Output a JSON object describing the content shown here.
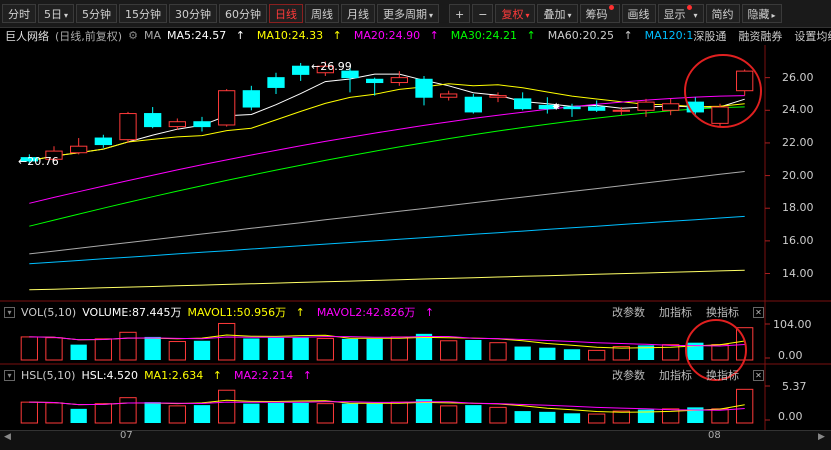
{
  "toolbar": {
    "periods": [
      "分时",
      "5日",
      "5分钟",
      "15分钟",
      "30分钟",
      "60分钟",
      "日线",
      "周线",
      "月线",
      "更多周期"
    ],
    "active_period": "日线",
    "plus": "+",
    "minus": "−",
    "fuquan": "复权",
    "diejia": "叠加",
    "chouma": "筹码",
    "huaxian": "画线",
    "xianshi": "显示",
    "jianyue": "简约",
    "yincang": "隐藏"
  },
  "ma_bar": {
    "stock_name": "巨人网络",
    "mode": "(日线,前复权)",
    "ma_label": "MA",
    "ma5": "MA5:24.57",
    "ma10": "MA10:24.33",
    "ma20": "MA20:24.90",
    "ma30": "MA30:24.21",
    "ma60": "MA60:20.25",
    "ma120": "MA120:1",
    "shengutong": "深股通",
    "rongzi": "融资融券",
    "shezhi": "设置均线",
    "colors": {
      "ma5": "#ffffff",
      "ma10": "#ffff00",
      "ma20": "#ff00ff",
      "ma30": "#00ff00",
      "ma60": "#aaaaaa",
      "ma120": "#00bfff"
    }
  },
  "price_axis": [
    "26.00",
    "24.00",
    "22.00",
    "20.00",
    "18.00",
    "16.00",
    "14.00"
  ],
  "annotations": {
    "high": "26.99",
    "low": "20.76",
    "star": "✸"
  },
  "vol_panel": {
    "title": "VOL(5,10)",
    "volume": "VOLUME:87.445万",
    "mavol1": "MAVOL1:50.956万",
    "mavol2": "MAVOL2:42.826万",
    "gaicanshu": "改参数",
    "jiazhibiao": "加指标",
    "huanzhibiao": "换指标",
    "close": "✕",
    "axis": [
      "104.00",
      "0.00"
    ]
  },
  "hsl_panel": {
    "title": "HSL(5,10)",
    "hsl": "HSL:4.520",
    "ma1": "MA1:2.634",
    "ma2": "MA2:2.214",
    "gaicanshu": "改参数",
    "jiazhibiao": "加指标",
    "huanzhibiao": "换指标",
    "close": "✕",
    "axis": [
      "5.37",
      "0.00"
    ]
  },
  "x_axis": {
    "left": "07",
    "right": "08"
  },
  "candles": [
    {
      "o": 21.1,
      "c": 20.9,
      "h": 21.3,
      "l": 20.76,
      "up": false
    },
    {
      "o": 21.0,
      "c": 21.5,
      "h": 21.8,
      "l": 20.9,
      "up": true
    },
    {
      "o": 21.4,
      "c": 21.8,
      "h": 22.3,
      "l": 21.3,
      "up": true
    },
    {
      "o": 21.9,
      "c": 22.3,
      "h": 22.5,
      "l": 21.7,
      "up": false
    },
    {
      "o": 22.2,
      "c": 23.8,
      "h": 23.9,
      "l": 22.0,
      "up": true
    },
    {
      "o": 23.8,
      "c": 23.0,
      "h": 24.2,
      "l": 22.9,
      "up": false
    },
    {
      "o": 23.0,
      "c": 23.3,
      "h": 23.5,
      "l": 22.8,
      "up": true
    },
    {
      "o": 23.3,
      "c": 23.0,
      "h": 23.6,
      "l": 22.7,
      "up": false
    },
    {
      "o": 23.1,
      "c": 25.2,
      "h": 25.3,
      "l": 23.0,
      "up": true
    },
    {
      "o": 25.2,
      "c": 24.2,
      "h": 25.5,
      "l": 24.0,
      "up": false
    },
    {
      "o": 25.4,
      "c": 26.0,
      "h": 26.3,
      "l": 25.0,
      "up": false
    },
    {
      "o": 26.2,
      "c": 26.7,
      "h": 26.9,
      "l": 25.8,
      "up": false
    },
    {
      "o": 26.3,
      "c": 26.7,
      "h": 26.99,
      "l": 26.1,
      "up": true
    },
    {
      "o": 26.4,
      "c": 26.0,
      "h": 26.6,
      "l": 25.1,
      "up": false
    },
    {
      "o": 25.9,
      "c": 25.7,
      "h": 26.0,
      "l": 24.9,
      "up": false
    },
    {
      "o": 25.7,
      "c": 26.0,
      "h": 26.4,
      "l": 25.5,
      "up": true
    },
    {
      "o": 25.9,
      "c": 24.8,
      "h": 26.1,
      "l": 24.3,
      "up": false
    },
    {
      "o": 24.8,
      "c": 25.0,
      "h": 25.2,
      "l": 24.6,
      "up": true
    },
    {
      "o": 24.8,
      "c": 23.9,
      "h": 25.0,
      "l": 23.8,
      "up": false
    },
    {
      "o": 24.8,
      "c": 24.9,
      "h": 25.1,
      "l": 24.5,
      "up": true
    },
    {
      "o": 24.7,
      "c": 24.1,
      "h": 25.1,
      "l": 24.0,
      "up": false
    },
    {
      "o": 24.3,
      "c": 24.1,
      "h": 24.8,
      "l": 23.8,
      "up": false
    },
    {
      "o": 24.1,
      "c": 24.2,
      "h": 24.4,
      "l": 23.6,
      "up": false
    },
    {
      "o": 24.0,
      "c": 24.2,
      "h": 24.6,
      "l": 23.9,
      "up": false
    },
    {
      "o": 24.0,
      "c": 24.0,
      "h": 24.2,
      "l": 23.7,
      "up": true
    },
    {
      "o": 24.0,
      "c": 24.5,
      "h": 24.7,
      "l": 23.6,
      "up": true
    },
    {
      "o": 24.0,
      "c": 24.4,
      "h": 24.7,
      "l": 23.7,
      "up": true
    },
    {
      "o": 24.5,
      "c": 23.9,
      "h": 24.8,
      "l": 23.6,
      "up": false
    },
    {
      "o": 23.2,
      "c": 24.2,
      "h": 24.4,
      "l": 23.0,
      "up": true
    },
    {
      "o": 25.2,
      "c": 26.4,
      "h": 26.5,
      "l": 24.9,
      "up": true
    }
  ],
  "volumes": [
    {
      "v": 60,
      "up": true
    },
    {
      "v": 58,
      "up": true
    },
    {
      "v": 40,
      "up": false
    },
    {
      "v": 55,
      "up": true
    },
    {
      "v": 72,
      "up": true
    },
    {
      "v": 60,
      "up": false
    },
    {
      "v": 48,
      "up": true
    },
    {
      "v": 50,
      "up": false
    },
    {
      "v": 95,
      "up": true
    },
    {
      "v": 56,
      "up": false
    },
    {
      "v": 58,
      "up": false
    },
    {
      "v": 58,
      "up": false
    },
    {
      "v": 56,
      "up": true
    },
    {
      "v": 55,
      "up": false
    },
    {
      "v": 55,
      "up": false
    },
    {
      "v": 60,
      "up": true
    },
    {
      "v": 68,
      "up": false
    },
    {
      "v": 50,
      "up": true
    },
    {
      "v": 52,
      "up": false
    },
    {
      "v": 45,
      "up": true
    },
    {
      "v": 35,
      "up": false
    },
    {
      "v": 32,
      "up": false
    },
    {
      "v": 28,
      "up": false
    },
    {
      "v": 25,
      "up": true
    },
    {
      "v": 35,
      "up": true
    },
    {
      "v": 38,
      "up": false
    },
    {
      "v": 40,
      "up": true
    },
    {
      "v": 45,
      "up": false
    },
    {
      "v": 40,
      "up": true
    },
    {
      "v": 84,
      "up": true
    }
  ],
  "hsl": [
    {
      "v": 2.8,
      "up": true
    },
    {
      "v": 2.7,
      "up": true
    },
    {
      "v": 1.9,
      "up": false
    },
    {
      "v": 2.6,
      "up": true
    },
    {
      "v": 3.4,
      "up": true
    },
    {
      "v": 2.8,
      "up": false
    },
    {
      "v": 2.3,
      "up": true
    },
    {
      "v": 2.4,
      "up": false
    },
    {
      "v": 4.4,
      "up": true
    },
    {
      "v": 2.6,
      "up": false
    },
    {
      "v": 2.7,
      "up": false
    },
    {
      "v": 2.7,
      "up": false
    },
    {
      "v": 2.6,
      "up": true
    },
    {
      "v": 2.6,
      "up": false
    },
    {
      "v": 2.6,
      "up": false
    },
    {
      "v": 2.8,
      "up": true
    },
    {
      "v": 3.2,
      "up": false
    },
    {
      "v": 2.3,
      "up": true
    },
    {
      "v": 2.4,
      "up": false
    },
    {
      "v": 2.1,
      "up": true
    },
    {
      "v": 1.6,
      "up": false
    },
    {
      "v": 1.5,
      "up": false
    },
    {
      "v": 1.3,
      "up": false
    },
    {
      "v": 1.2,
      "up": true
    },
    {
      "v": 1.6,
      "up": true
    },
    {
      "v": 1.8,
      "up": false
    },
    {
      "v": 1.9,
      "up": true
    },
    {
      "v": 2.1,
      "up": false
    },
    {
      "v": 1.9,
      "up": true
    },
    {
      "v": 4.52,
      "up": true
    }
  ]
}
